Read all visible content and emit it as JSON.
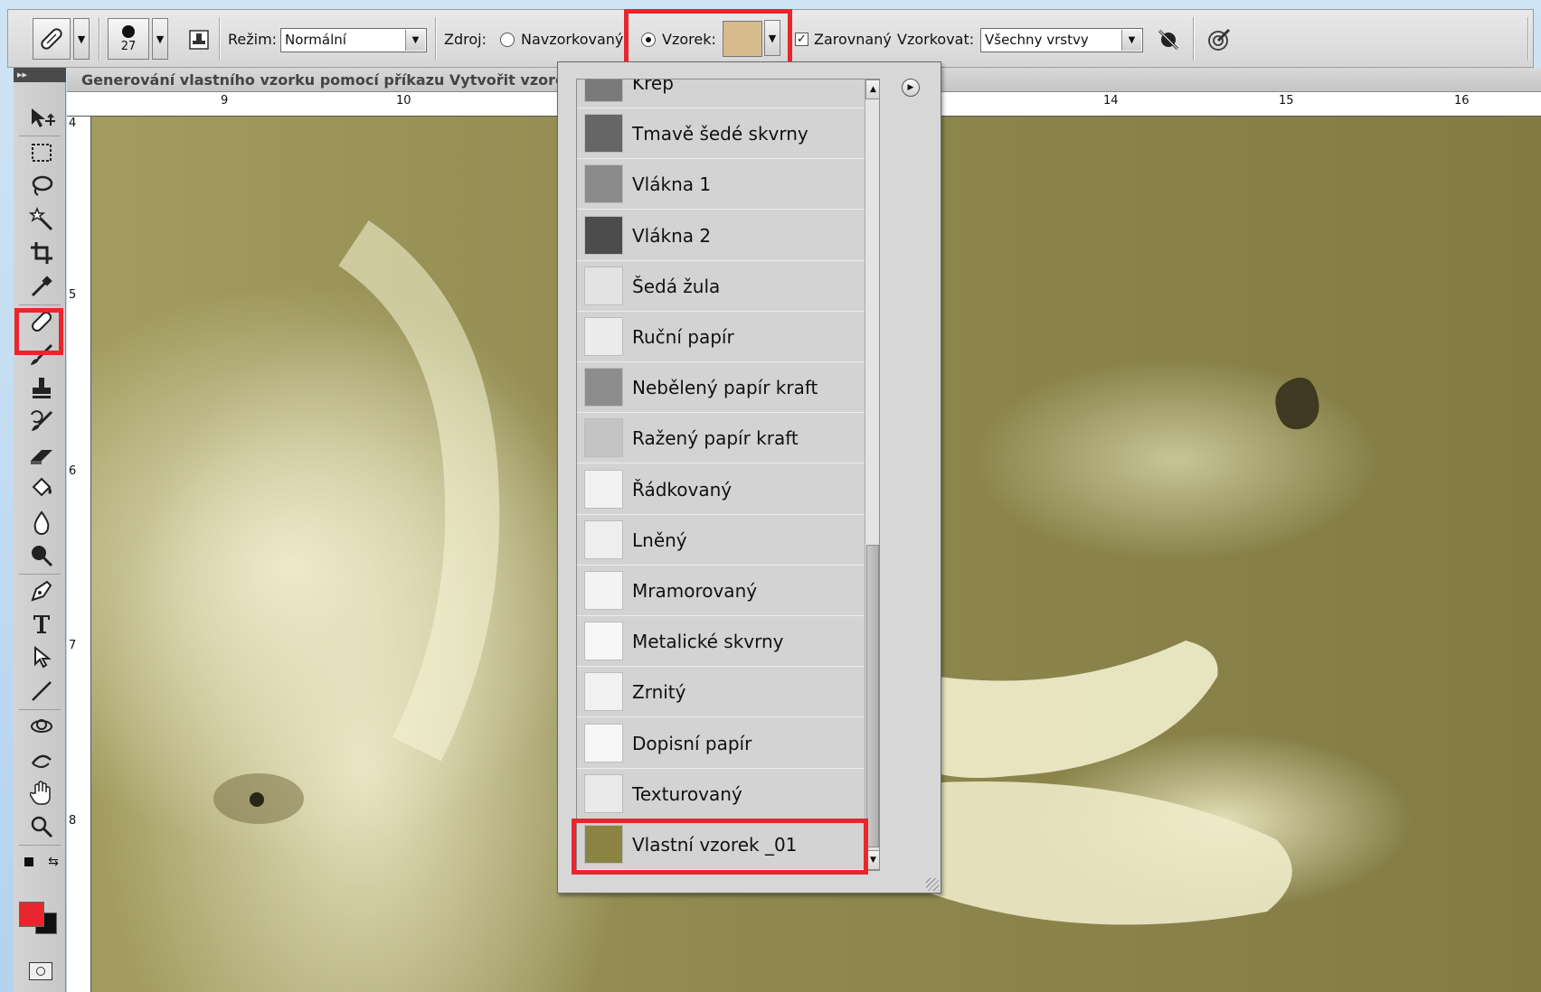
{
  "options_bar": {
    "brush_size": "27",
    "mode_label": "Režim:",
    "mode_value": "Normální",
    "source_label": "Zdroj:",
    "source_options": [
      {
        "label": "Navzorkovaný",
        "selected": false
      },
      {
        "label": "Vzorek:",
        "selected": true
      }
    ],
    "pattern_swatch_color": "#d8bb8d",
    "aligned_label": "Zarovnaný",
    "aligned_checked": true,
    "sample_label": "Vzorkovat:",
    "sample_value": "Všechny vrstvy"
  },
  "document": {
    "title": "Generování vlastního vzorku pomocí příkazu Vytvořit vzorek.j",
    "ruler_top_numbers": [
      "9",
      "10",
      "14",
      "15",
      "16"
    ],
    "ruler_left_numbers": [
      "4",
      "5",
      "6",
      "7",
      "8"
    ]
  },
  "tools_panel": {
    "header": "▸▸",
    "foreground_color": "#e8262d",
    "background_color": "#111111",
    "tools": [
      "move-tool-icon",
      "marquee-tool-icon",
      "lasso-tool-icon",
      "magic-wand-tool-icon",
      "crop-tool-icon",
      "eyedropper-tool-icon",
      "healing-brush-tool-icon",
      "brush-tool-icon",
      "clone-stamp-tool-icon",
      "history-brush-tool-icon",
      "eraser-tool-icon",
      "paint-bucket-tool-icon",
      "blur-tool-icon",
      "dodge-tool-icon",
      "pen-tool-icon",
      "type-tool-icon",
      "path-selection-tool-icon",
      "line-tool-icon",
      "3d-rotate-tool-icon",
      "3d-orbit-tool-icon",
      "hand-tool-icon",
      "zoom-tool-icon"
    ]
  },
  "pattern_picker": {
    "patterns": [
      {
        "label": "Krep",
        "swatch": "#7a7a7a"
      },
      {
        "label": "Tmavě šedé skvrny",
        "swatch": "#666666"
      },
      {
        "label": "Vlákna 1",
        "swatch": "#8b8b8b"
      },
      {
        "label": "Vlákna 2",
        "swatch": "#4c4c4c"
      },
      {
        "label": "Šedá žula",
        "swatch": "#e3e3e3"
      },
      {
        "label": "Ruční papír",
        "swatch": "#ececec"
      },
      {
        "label": "Nebělený papír kraft",
        "swatch": "#8d8d8d"
      },
      {
        "label": "Ražený papír kraft",
        "swatch": "#c4c4c4"
      },
      {
        "label": "Řádkovaný",
        "swatch": "#f1f1f1"
      },
      {
        "label": "Lněný",
        "swatch": "#eeeeee"
      },
      {
        "label": "Mramorovaný",
        "swatch": "#f3f3f3"
      },
      {
        "label": "Metalické skvrny",
        "swatch": "#f7f7f7"
      },
      {
        "label": "Zrnitý",
        "swatch": "#f1f1f1"
      },
      {
        "label": "Dopisní papír",
        "swatch": "#f6f6f6"
      },
      {
        "label": "Texturovaný",
        "swatch": "#e9e9e9"
      },
      {
        "label": "Vlastní vzorek _01",
        "swatch": "#8a8342",
        "highlighted": true
      }
    ]
  },
  "highlight_color": "#e8262d"
}
